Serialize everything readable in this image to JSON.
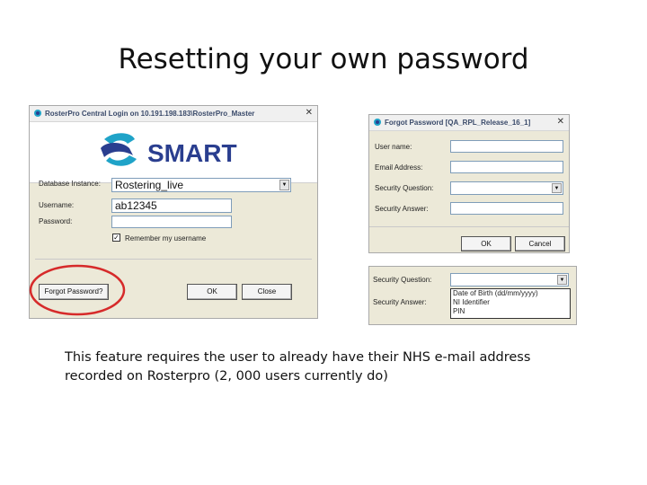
{
  "slide": {
    "title": "Resetting your own password",
    "caption_lines": [
      "This feature requires the user to already have  their NHS e-mail address",
      "recorded on Rosterpro (2, 000 users currently do)"
    ]
  },
  "login_dialog": {
    "title": "RosterPro Central Login on 10.191.198.183\\RosterPro_Master",
    "logo_text": "SMART",
    "brand_colors": {
      "navy": "#2a3e8f",
      "teal": "#1fa3c8"
    },
    "fields": {
      "database_label": "Database Instance:",
      "database_value": "Rostering_live",
      "username_label": "Username:",
      "username_value": "ab12345",
      "password_label": "Password:",
      "remember_label": "Remember my username"
    },
    "buttons": {
      "forgot": "Forgot Password?",
      "ok": "OK",
      "close": "Close"
    },
    "highlight_color": "#d62a2a"
  },
  "forgot_dialog": {
    "title": "Forgot Password    [QA_RPL_Release_16_1]",
    "labels": {
      "user_name": "User name:",
      "email": "Email Address:",
      "security_question": "Security Question:",
      "security_answer": "Security Answer:"
    },
    "buttons": {
      "ok": "OK",
      "cancel": "Cancel"
    }
  },
  "security_dropdown": {
    "question_label": "Security Question:",
    "answer_label": "Security Answer:",
    "options": [
      "Date of Birth (dd/mm/yyyy)",
      "NI Identifier",
      "PIN"
    ]
  }
}
